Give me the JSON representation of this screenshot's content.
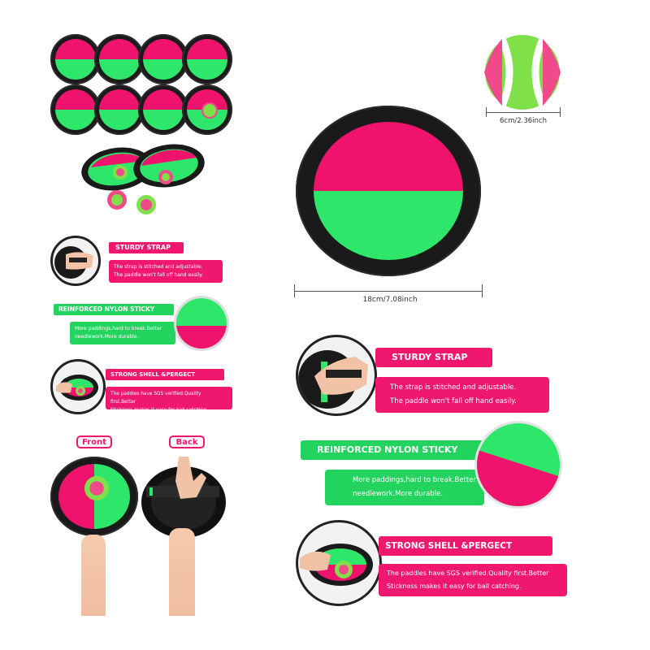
{
  "colors": {
    "pink": "#f0136e",
    "green": "#2ee66a",
    "rim": "#1a1a1a",
    "ball_green": "#7fe04a",
    "ball_pink": "#f04a8a"
  },
  "dimensions": {
    "ball": "6cm/2.36inch",
    "paddle": "18cm/7.08inch"
  },
  "features": [
    {
      "title": "STURDY STRAP",
      "description_lines": [
        "The strap is stitched and adjustable.",
        "The paddle won't fall off hand easily."
      ]
    },
    {
      "title": "REINFORCED NYLON STICKY CLOTH",
      "description_lines": [
        "More paddings,hard to break.Better",
        "needlework.More durable."
      ]
    },
    {
      "title": "STRONG SHELL &PERGECT VISCOSITY",
      "description_lines": [
        "The paddles have SGS verified.Quality first.Better",
        "Stickness makes it easy for ball catching."
      ]
    }
  ],
  "views": {
    "front": "Front",
    "back": "Back"
  },
  "icons": [
    "paddle-icon",
    "ball-icon",
    "hand-icon"
  ]
}
